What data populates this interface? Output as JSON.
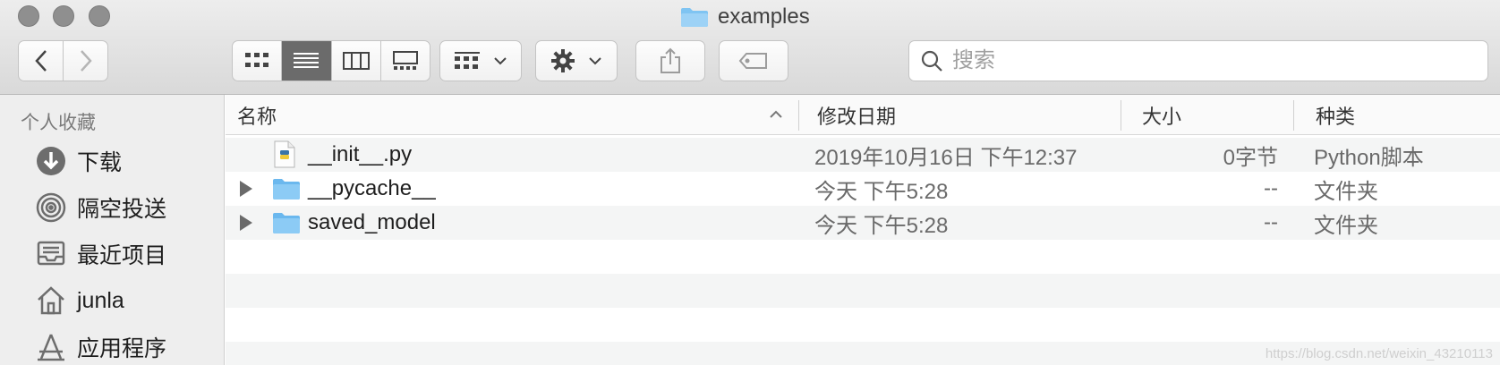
{
  "window": {
    "title": "examples"
  },
  "toolbar": {
    "back_icon": "chevron-left-icon",
    "forward_icon": "chevron-right-icon",
    "view_modes": [
      "icon-view",
      "list-view",
      "column-view",
      "gallery-view"
    ],
    "active_view": "list-view",
    "search_placeholder": "搜索"
  },
  "sidebar": {
    "heading": "个人收藏",
    "items": [
      {
        "label": "下载",
        "icon": "download-icon"
      },
      {
        "label": "隔空投送",
        "icon": "airdrop-icon"
      },
      {
        "label": "最近项目",
        "icon": "recents-icon"
      },
      {
        "label": "junla",
        "icon": "home-icon"
      },
      {
        "label": "应用程序",
        "icon": "applications-icon"
      }
    ]
  },
  "columns": {
    "name": "名称",
    "modified": "修改日期",
    "size": "大小",
    "kind": "种类"
  },
  "files": [
    {
      "name": "__init__.py",
      "modified": "2019年10月16日 下午12:37",
      "size": "0字节",
      "kind": "Python脚本"
    },
    {
      "name": "__pycache__",
      "modified": "今天 下午5:28",
      "size": "--",
      "kind": "文件夹"
    },
    {
      "name": "saved_model",
      "modified": "今天 下午5:28",
      "size": "--",
      "kind": "文件夹"
    }
  ],
  "watermark": "https://blog.csdn.net/weixin_43210113",
  "colors": {
    "folder": "#7fc4f2",
    "toolbar": "#e4e4e4",
    "sidebar": "#eeeeee",
    "active_segment": "#6b6b6b"
  }
}
